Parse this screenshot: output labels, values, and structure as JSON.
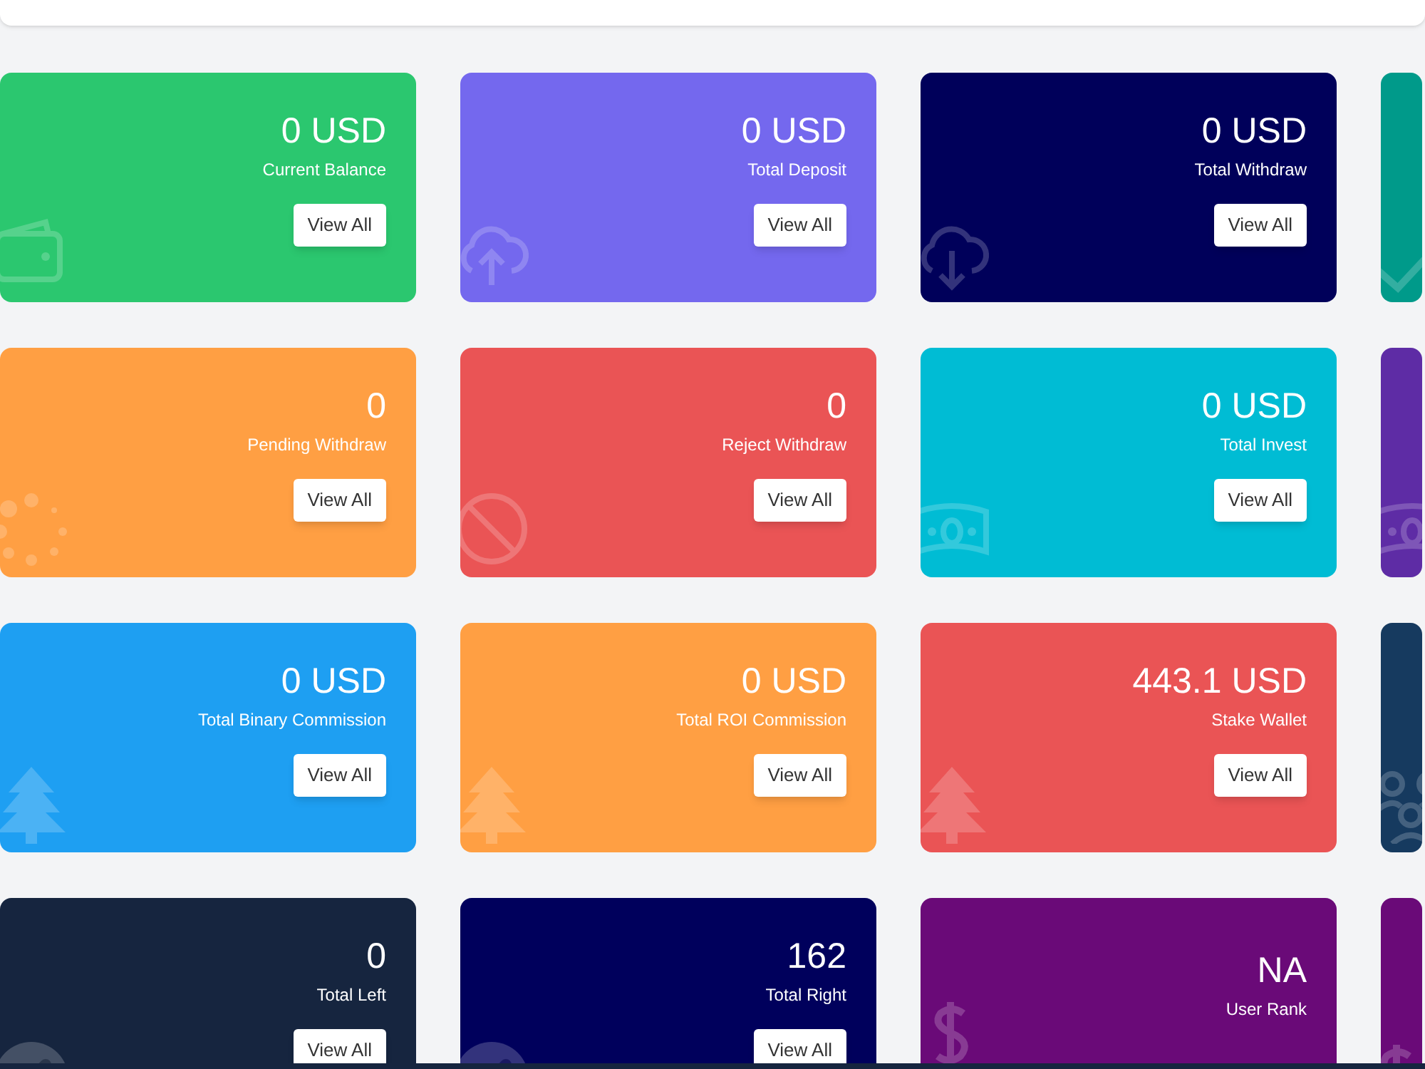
{
  "cards": [
    {
      "value": "0 USD",
      "label": "Current Balance",
      "button": "View All",
      "color": "#2bc76f"
    },
    {
      "value": "0 USD",
      "label": "Total Deposit",
      "button": "View All",
      "color": "#7468ee"
    },
    {
      "value": "0 USD",
      "label": "Total Withdraw",
      "button": "View All",
      "color": "#00005a"
    },
    {
      "color": "#009a8a"
    },
    {
      "value": "0",
      "label": "Pending Withdraw",
      "button": "View All",
      "color": "#ff9f43"
    },
    {
      "value": "0",
      "label": "Reject Withdraw",
      "button": "View All",
      "color": "#ea5455"
    },
    {
      "value": "0 USD",
      "label": "Total Invest",
      "button": "View All",
      "color": "#00bcd4"
    },
    {
      "color": "#5e2ca5"
    },
    {
      "value": "0 USD",
      "label": "Total Binary Commission",
      "button": "View All",
      "color": "#1e9ff2"
    },
    {
      "value": "0 USD",
      "label": "Total ROI Commission",
      "button": "View All",
      "color": "#ff9f43"
    },
    {
      "value": "443.1 USD",
      "label": "Stake Wallet",
      "button": "View All",
      "color": "#ea5455"
    },
    {
      "color": "#163a5f"
    },
    {
      "value": "0",
      "label": "Total Left",
      "button": "View All",
      "color": "#16253f"
    },
    {
      "value": "162",
      "label": "Total Right",
      "button": "View All",
      "color": "#00005c"
    },
    {
      "value": "NA",
      "label": "User Rank",
      "color": "#6a0a78"
    },
    {
      "color": "#6a0a78"
    }
  ]
}
